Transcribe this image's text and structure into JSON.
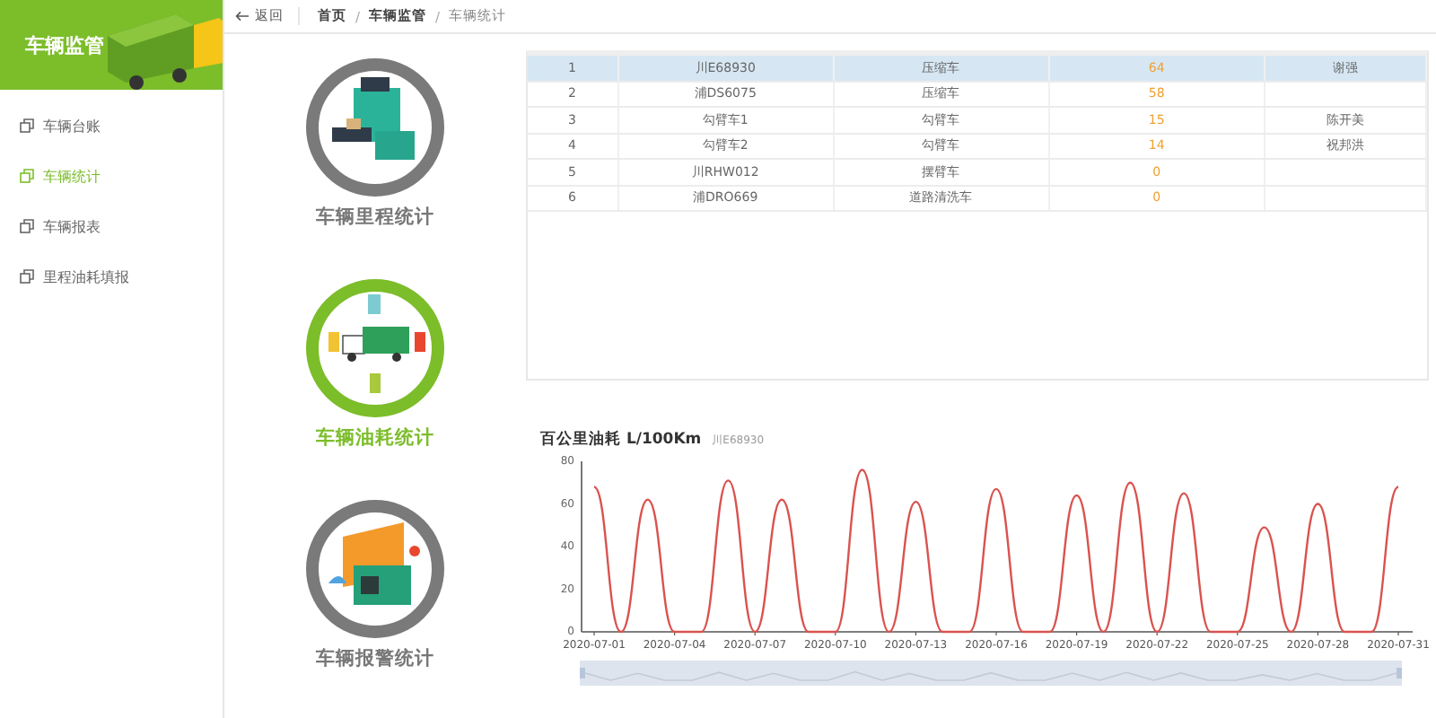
{
  "sidebar": {
    "title": "车辆监管",
    "items": [
      {
        "label": "车辆台账",
        "selected": false
      },
      {
        "label": "车辆统计",
        "selected": true
      },
      {
        "label": "车辆报表",
        "selected": false
      },
      {
        "label": "里程油耗填报",
        "selected": false
      }
    ]
  },
  "topbar": {
    "back": "返回",
    "separator": "/",
    "breadcrumb": [
      "首页",
      "车辆监管",
      "车辆统计"
    ]
  },
  "stat_cards": [
    {
      "kind": "mileage",
      "label": "车辆里程统计",
      "selected": false
    },
    {
      "kind": "fuel",
      "label": "车辆油耗统计",
      "selected": true
    },
    {
      "kind": "alarm",
      "label": "车辆报警统计",
      "selected": false
    }
  ],
  "table": {
    "rows": [
      {
        "column_1": "1",
        "column_2": "川E68930",
        "column_3": "压缩车",
        "column_4": "64",
        "column_5": "谢强",
        "selected": true
      },
      {
        "column_1": "2",
        "column_2": "浦DS6075",
        "column_3": "压缩车",
        "column_4": "58",
        "selected": false
      },
      {
        "column_1": "3",
        "column_2": "勾臂车1",
        "column_3": "勾臂车",
        "column_4": "15",
        "column_5": "陈开美",
        "selected": false
      },
      {
        "column_1": "4",
        "column_2": "勾臂车2",
        "column_3": "勾臂车",
        "column_4": "14",
        "column_5": "祝邦洪",
        "selected": false
      },
      {
        "column_1": "5",
        "column_2": "川RHW012",
        "column_3": "摆臂车",
        "column_4": "0",
        "selected": false
      },
      {
        "column_1": "6",
        "column_2": "浦DRO669",
        "column_3": "道路清洗车",
        "column_4": "0",
        "selected": false
      }
    ]
  },
  "chart": {
    "chart_data": {
      "type": "line",
      "title": "百公里油耗 L/100Km",
      "categories": [
        "2020-07-01",
        null,
        null,
        "2020-07-04",
        null,
        null,
        "2020-07-07",
        null,
        null,
        "2020-07-10",
        null,
        null,
        "2020-07-13",
        null,
        null,
        "2020-07-16",
        null,
        null,
        "2020-07-19",
        null,
        null,
        "2020-07-22",
        null,
        null,
        "2020-07-25",
        null,
        null,
        "2020-07-28",
        null,
        null,
        "2020-07-31"
      ],
      "series": [
        {
          "name": "川E68930",
          "color": "#d9534f",
          "values": [
            68,
            0,
            62,
            0,
            0,
            71,
            0,
            62,
            0,
            0,
            76,
            0,
            61,
            0,
            0,
            67,
            0,
            0,
            64,
            0,
            70,
            0,
            65,
            0,
            0,
            49,
            0,
            60,
            0,
            0,
            68
          ]
        }
      ],
      "ylim": [
        0,
        80
      ],
      "yticks": [
        0,
        20,
        40,
        60,
        80
      ]
    },
    "zoom_slider": {
      "level": 1
    }
  }
}
